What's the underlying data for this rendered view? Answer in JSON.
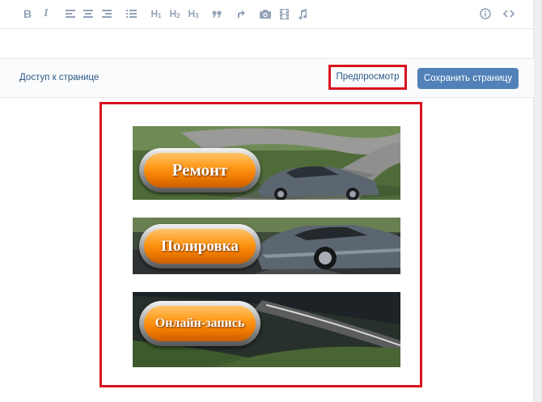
{
  "toolbar": {
    "items": [
      {
        "name": "bold",
        "label": "B"
      },
      {
        "name": "italic",
        "label": "I"
      },
      {
        "name": "h1",
        "label": "H1"
      },
      {
        "name": "h2",
        "label": "H2"
      },
      {
        "name": "h3",
        "label": "H3"
      },
      {
        "name": "quote",
        "label": "99"
      }
    ],
    "icons": [
      "align-left-icon",
      "align-center-icon",
      "align-right-icon",
      "list-icon",
      "quote-icon",
      "link-arrow-icon",
      "camera-icon",
      "film-icon",
      "music-note-icon",
      "info-icon",
      "code-icon"
    ]
  },
  "actionbar": {
    "access_label": "Доступ к странице",
    "preview_label": "Предпросмотр",
    "save_label": "Сохранить страницу",
    "accent_color": "#5181b8",
    "highlight_color": "#d9121e"
  },
  "banners": [
    {
      "label": "Ремонт"
    },
    {
      "label": "Полировка"
    },
    {
      "label": "Онлайн-запись"
    }
  ]
}
